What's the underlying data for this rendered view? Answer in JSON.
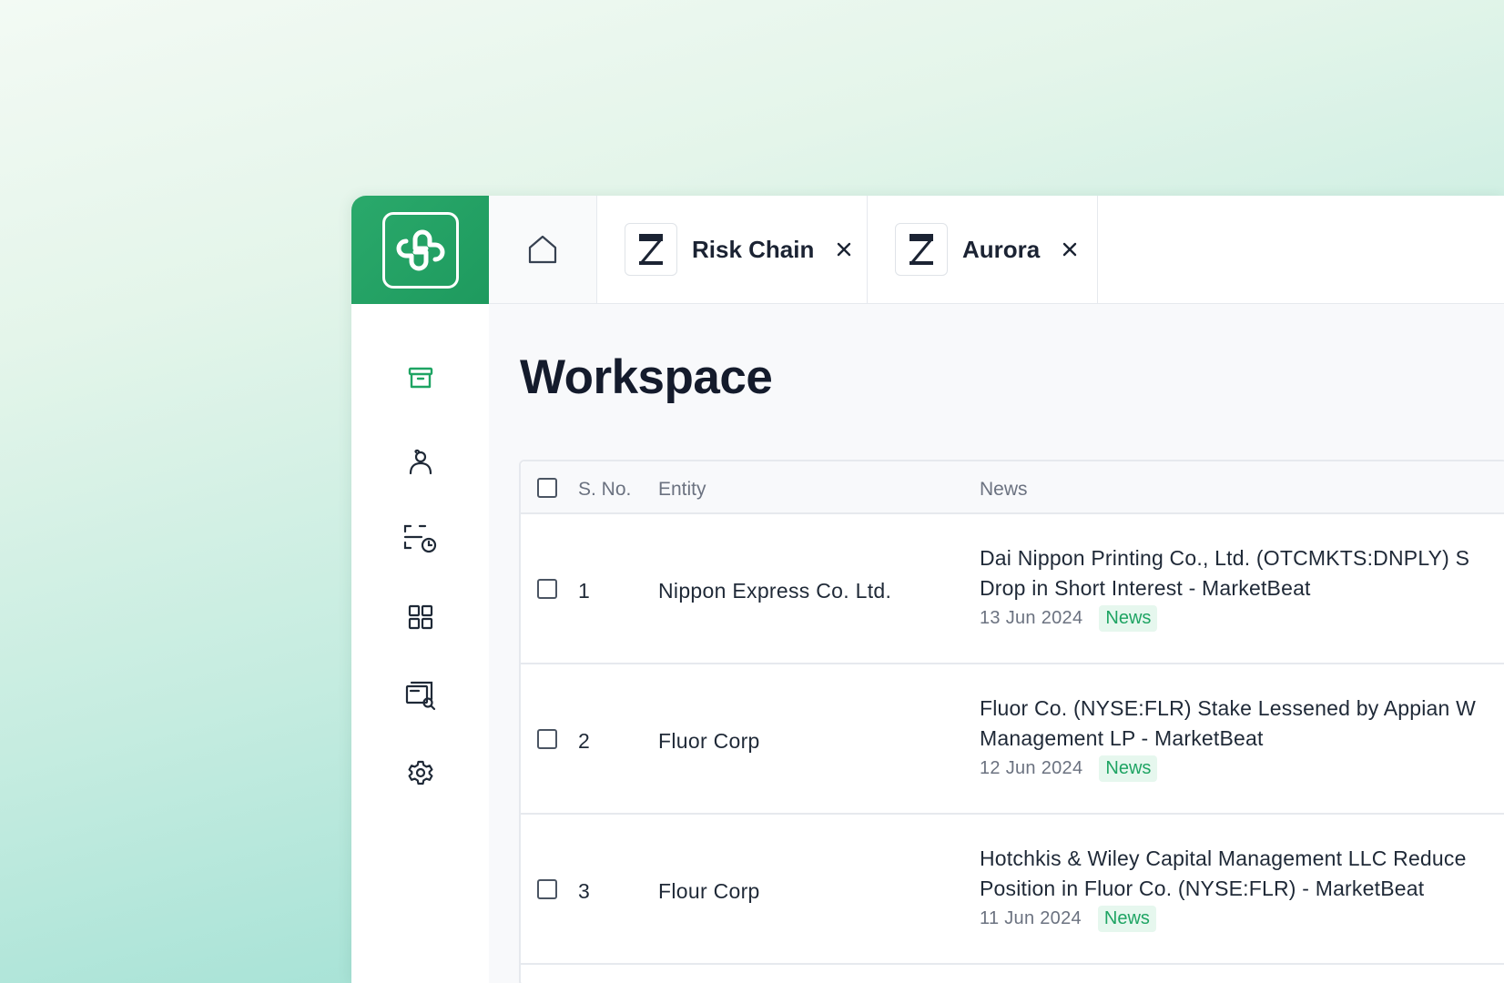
{
  "tabs": [
    {
      "label": "Risk Chain",
      "badge": "Z"
    },
    {
      "label": "Aurora",
      "badge": "Z"
    }
  ],
  "sidebar": {
    "icons": [
      "archive-icon",
      "user-icon",
      "scan-clock-icon",
      "grid-icon",
      "screen-search-icon",
      "gear-icon"
    ],
    "active_color": "#1ea463"
  },
  "page": {
    "title": "Workspace"
  },
  "table": {
    "headers": {
      "sno": "S. No.",
      "entity": "Entity",
      "news": "News"
    },
    "rows": [
      {
        "sno": "1",
        "entity": "Nippon Express Co. Ltd.",
        "news_line1": "Dai Nippon Printing Co., Ltd. (OTCMKTS:DNPLY) S",
        "news_line2": "Drop in Short Interest - MarketBeat",
        "date": "13 Jun 2024",
        "badge": "News"
      },
      {
        "sno": "2",
        "entity": "Fluor Corp",
        "news_line1": "Fluor Co. (NYSE:FLR) Stake Lessened by Appian W",
        "news_line2": "Management LP - MarketBeat",
        "date": "12 Jun 2024",
        "badge": "News"
      },
      {
        "sno": "3",
        "entity": "Flour Corp",
        "news_line1": "Hotchkis & Wiley Capital Management LLC Reduce",
        "news_line2": "Position in Fluor Co. (NYSE:FLR) - MarketBeat",
        "date": "11 Jun 2024",
        "badge": "News"
      }
    ]
  },
  "colors": {
    "brand": "#1e9a5e",
    "badge_text": "#1ea463",
    "badge_bg": "#e6f7ee"
  }
}
